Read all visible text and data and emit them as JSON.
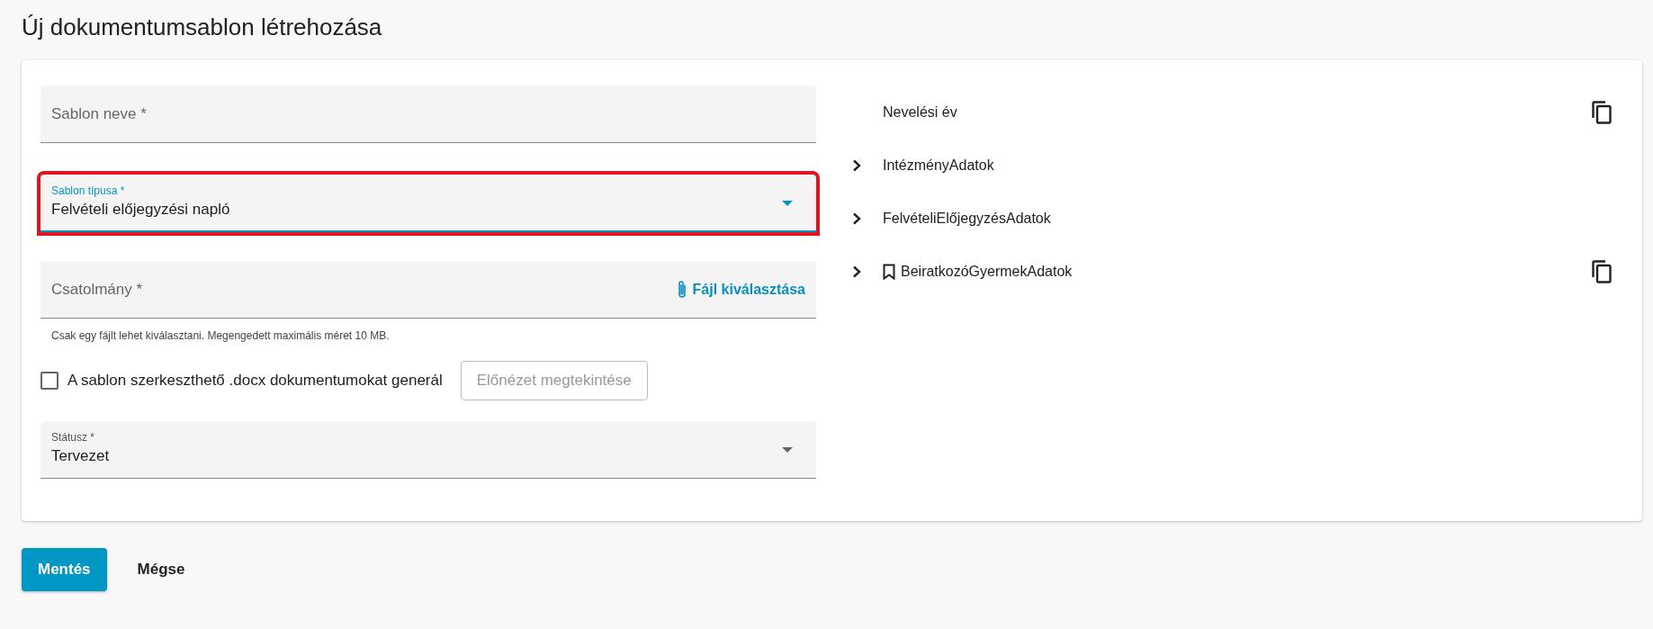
{
  "page_title": "Új dokumentumsablon létrehozása",
  "form": {
    "name_field": {
      "placeholder": "Sablon neve *"
    },
    "type_field": {
      "label": "Sablon típusa *",
      "value": "Felvételi előjegyzési napló",
      "focused": true,
      "highlighted": true
    },
    "attachment_field": {
      "placeholder": "Csatolmány *",
      "button": "Fájl kiválasztása",
      "hint": "Csak egy fájlt lehet kiválasztani. Megengedett maximális méret 10 MB."
    },
    "editable_checkbox": {
      "label": "A sablon szerkeszthető .docx dokumentumokat generál",
      "checked": false
    },
    "preview_button": {
      "label": "Előnézet megtekintése",
      "disabled": true
    },
    "status_field": {
      "label": "Státusz *",
      "value": "Tervezet",
      "focused": false,
      "highlighted": false
    }
  },
  "tree": [
    {
      "kind": "field",
      "label": "Nevelési év",
      "bookmarked": false,
      "copyable": true
    },
    {
      "kind": "group",
      "label": "IntézményAdatok",
      "bookmarked": false,
      "copyable": false
    },
    {
      "kind": "group",
      "label": "FelvételiElőjegyzésAdatok",
      "bookmarked": false,
      "copyable": false
    },
    {
      "kind": "group",
      "label": "BeiratkozóGyermekAdatok",
      "bookmarked": true,
      "copyable": true
    }
  ],
  "actions": [
    {
      "label": "Mentés",
      "primary": true
    },
    {
      "label": "Mégse",
      "primary": false
    }
  ]
}
